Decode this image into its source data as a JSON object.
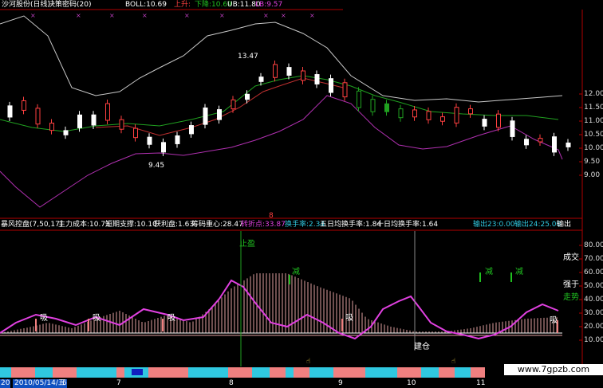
{
  "top": {
    "stock_title": "沙河股份(日线)",
    "indicator_name": "决策密码(20)",
    "boll_label": "BOLL:10.69",
    "up_label": "上升:",
    "down_label": "下降:10.69",
    "ub_label": "UB:11.80",
    "lb_label": "LB:9.57"
  },
  "price_axis": [
    "12.00",
    "11.50",
    "11.00",
    "10.50",
    "10.00",
    "9.50",
    "9.00"
  ],
  "annotations": {
    "high_price": "13.47",
    "low_price": "9.45",
    "mid_marker": "8"
  },
  "indicator_bar": {
    "name": "暴风控盘(7,50,17)",
    "main_cost": "主力成本:10.73",
    "short_support": "短期支撑:10.10",
    "profit": "获利盘:1.63",
    "chip_center": "筹码重心:28.47",
    "turn": "转折点:33.87",
    "turnover": "换手率:2.34",
    "avg5": "五日均换手率:1.84",
    "avg10": "十日均换手率:1.64",
    "out1": "输出23:0.00",
    "out2": "输出24:25.00",
    "out3": "输出"
  },
  "lower_labels": {
    "stop_profit": "止盈",
    "reduce1": "减",
    "reduce2": "减",
    "reduce3": "减",
    "absorb1": "吸",
    "absorb2": "吸",
    "absorb3": "吸",
    "absorb4": "吸",
    "build_position": "建仓",
    "volume": "成交",
    "strong": "强于",
    "trend": "走势"
  },
  "lower_axis": [
    "80.00",
    "70.00",
    "60.00",
    "50.00",
    "40.00",
    "30.00",
    "20.00",
    "10.00"
  ],
  "dates": [
    "20",
    "2010/05/14/五",
    "6",
    "7",
    "8",
    "9",
    "10",
    "11"
  ],
  "watermark": "www.7gpzb.com",
  "colors": {
    "up": "#ff4040",
    "down": "#ffffff",
    "mid_line": "#20a020",
    "upper_band": "#c8c8c8",
    "lower_band": "#b030b0",
    "avg_line": "#c03030",
    "purple_curve": "#e040e0",
    "hatch": "#e0a0a0",
    "cyan_band": "#30c8e0",
    "pink_band": "#f08080"
  }
}
